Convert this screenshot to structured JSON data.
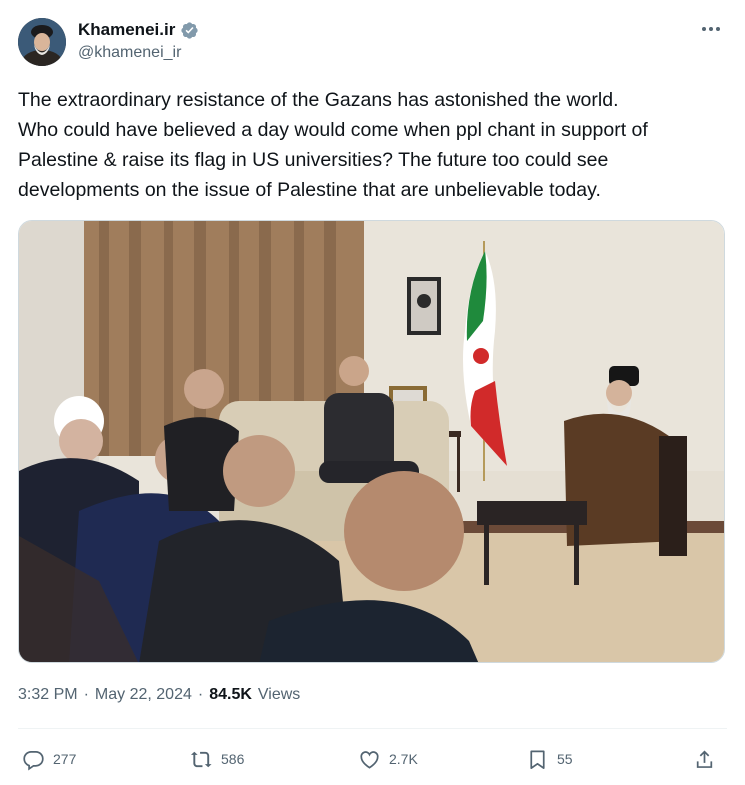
{
  "author": {
    "display_name": "Khamenei.ir",
    "handle": "@khamenei_ir",
    "verified_icon": "verified-badge-icon",
    "verified_color": "#829aab"
  },
  "tweet": {
    "text": "The extraordinary resistance of the Gazans has astonished the world.\nWho could have believed a day would come when ppl chant in support of\nPalestine & raise its flag in US universities? The future too could see\ndevelopments on the issue of Palestine that are unbelievable today."
  },
  "meta": {
    "time": "3:32 PM",
    "separator": "·",
    "date": "May 22, 2024",
    "views_count": "84.5K",
    "views_label": "Views"
  },
  "actions": {
    "replies": "277",
    "reposts": "586",
    "likes": "2.7K",
    "bookmarks": "55"
  },
  "colors": {
    "text": "#0f1419",
    "secondary": "#536471",
    "divider": "#eff3f4"
  }
}
